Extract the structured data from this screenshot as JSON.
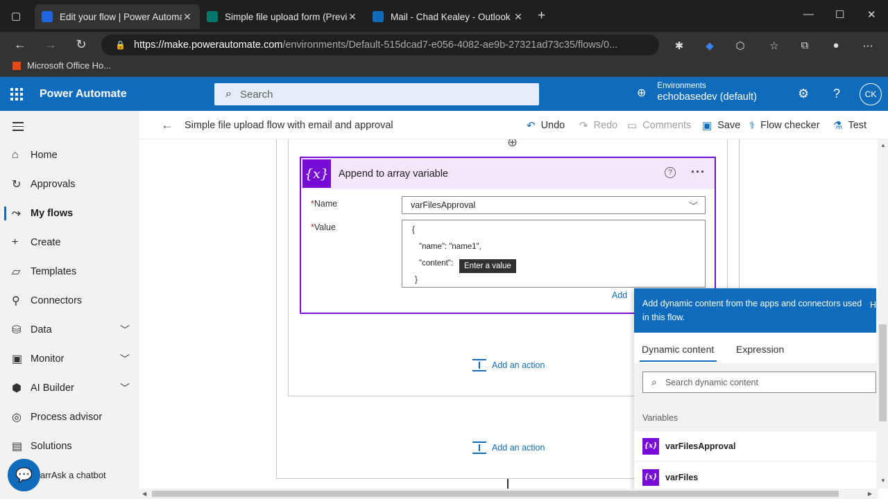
{
  "browser": {
    "tabs": [
      {
        "label": "Edit your flow | Power Automate",
        "active": true
      },
      {
        "label": "Simple file upload form (Preview",
        "active": false
      },
      {
        "label": "Mail - Chad Kealey - Outlook",
        "active": false
      }
    ],
    "url_host": "https://make.powerautomate.com",
    "url_path": "/environments/Default-515dcad7-e056-4082-ae9b-27321ad73c35/flows/0...",
    "bookmark": "Microsoft Office Ho..."
  },
  "header": {
    "app_name": "Power Automate",
    "search_placeholder": "Search",
    "env_label": "Environments",
    "env_value": "echobasedev (default)",
    "avatar": "CK"
  },
  "sidebar": {
    "items": [
      {
        "label": "Home",
        "icon": "home-icon"
      },
      {
        "label": "Approvals",
        "icon": "approvals-icon"
      },
      {
        "label": "My flows",
        "icon": "flows-icon",
        "selected": true
      },
      {
        "label": "Create",
        "icon": "plus-icon"
      },
      {
        "label": "Templates",
        "icon": "templates-icon"
      },
      {
        "label": "Connectors",
        "icon": "connectors-icon"
      },
      {
        "label": "Data",
        "icon": "data-icon",
        "expandable": true
      },
      {
        "label": "Monitor",
        "icon": "monitor-icon",
        "expandable": true
      },
      {
        "label": "AI Builder",
        "icon": "ai-builder-icon",
        "expandable": true
      },
      {
        "label": "Process advisor",
        "icon": "process-advisor-icon"
      },
      {
        "label": "Solutions",
        "icon": "solutions-icon"
      }
    ],
    "chatbot_label": "arrAsk a chatbot"
  },
  "commandbar": {
    "flow_title": "Simple file upload flow with email and approval",
    "undo": "Undo",
    "redo": "Redo",
    "comments": "Comments",
    "save": "Save",
    "flow_checker": "Flow checker",
    "test": "Test"
  },
  "card": {
    "title": "Append to array variable",
    "name_label": "Name",
    "name_value": "varFilesApproval",
    "value_label": "Value",
    "value_lines": [
      "{",
      "\"name\": \"name1\",",
      "\"content\":",
      "}"
    ],
    "tooltip": "Enter a value",
    "add_link": "Add"
  },
  "canvas": {
    "add_action_1": "Add an action",
    "add_action_2": "Add an action"
  },
  "dynamic_panel": {
    "header_text": "Add dynamic content from the apps and connectors used in this flow.",
    "hide_label": "H",
    "tab_dynamic": "Dynamic content",
    "tab_expression": "Expression",
    "search_placeholder": "Search dynamic content",
    "group_label": "Variables",
    "items": [
      "varFilesApproval",
      "varFiles"
    ]
  },
  "colors": {
    "brand_blue": "#0f6cbd",
    "variable_purple": "#770bd6",
    "card_header_bg": "#f4e6fc"
  }
}
